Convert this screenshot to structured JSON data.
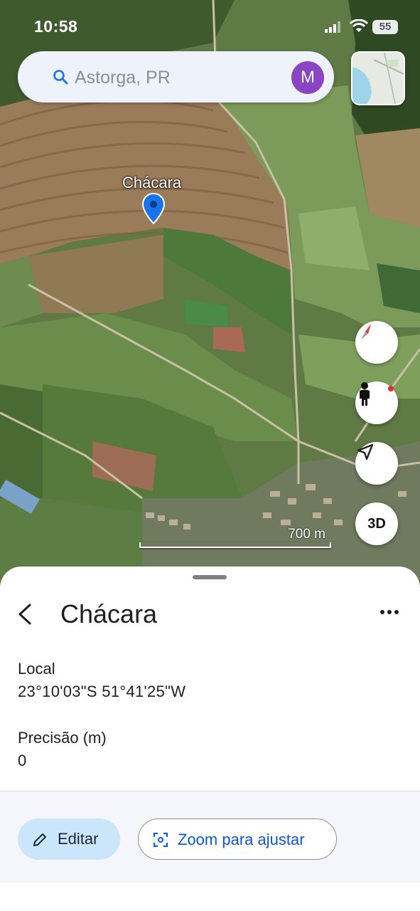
{
  "status_bar": {
    "time": "10:58",
    "battery": "55"
  },
  "search": {
    "placeholder": "Astorga, PR",
    "avatar_letter": "M"
  },
  "map": {
    "pin_label": "Chácara",
    "scale_label": "700 m",
    "button_3d": "3D",
    "icons": [
      "compass-icon",
      "pegman-icon",
      "navigation-arrow-icon",
      "layers-icon"
    ]
  },
  "place": {
    "title": "Chácara",
    "local_label": "Local",
    "local_value": "23°10'03\"S 51°41'25\"W",
    "precision_label": "Precisão (m)",
    "precision_value": "0"
  },
  "actions": {
    "edit_label": "Editar",
    "zoom_label": "Zoom para ajustar"
  },
  "colors": {
    "accent_blue": "#0b57d0",
    "edit_bg": "#cbe6fb",
    "avatar": "#8b44c4",
    "pin": "#1a73e8"
  }
}
